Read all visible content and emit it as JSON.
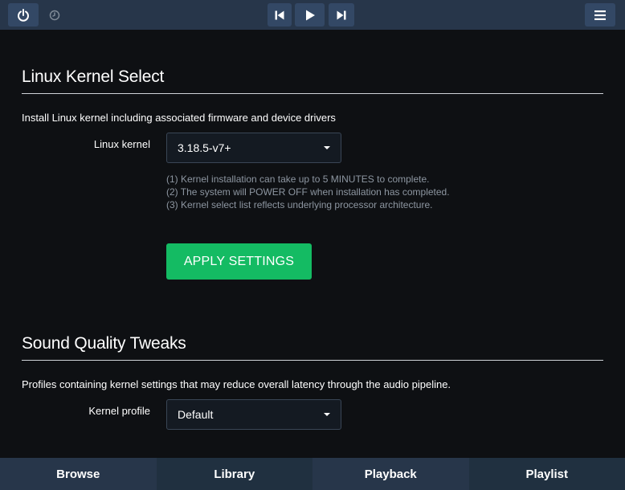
{
  "topbar": {
    "icons": {
      "power": "power-icon",
      "clock": "clock-icon",
      "prev": "skip-previous-icon",
      "play": "play-icon",
      "next": "skip-next-icon",
      "menu": "hamburger-menu-icon"
    }
  },
  "kernel_section": {
    "title": "Linux Kernel Select",
    "description": "Install Linux kernel including associated firmware and device drivers",
    "field_label": "Linux kernel",
    "selected_value": "3.18.5-v7+",
    "help_lines": [
      "(1) Kernel installation can take up to 5 MINUTES to complete.",
      "(2) The system will POWER OFF when installation has completed.",
      "(3) Kernel select list reflects underlying processor architecture."
    ],
    "apply_label": "APPLY SETTINGS"
  },
  "sound_section": {
    "title": "Sound Quality Tweaks",
    "description": "Profiles containing kernel settings that may reduce overall latency through the audio pipeline.",
    "field_label": "Kernel profile",
    "selected_value": "Default"
  },
  "bottom_nav": {
    "items": [
      {
        "label": "Browse",
        "color": "#27364a"
      },
      {
        "label": "Library",
        "color": "#203040"
      },
      {
        "label": "Playback",
        "color": "#27364a"
      },
      {
        "label": "Playlist",
        "color": "#203040"
      }
    ]
  },
  "colors": {
    "accent_green": "#14bb63",
    "topbar_bg": "#27364a",
    "page_bg": "#0e1013"
  }
}
